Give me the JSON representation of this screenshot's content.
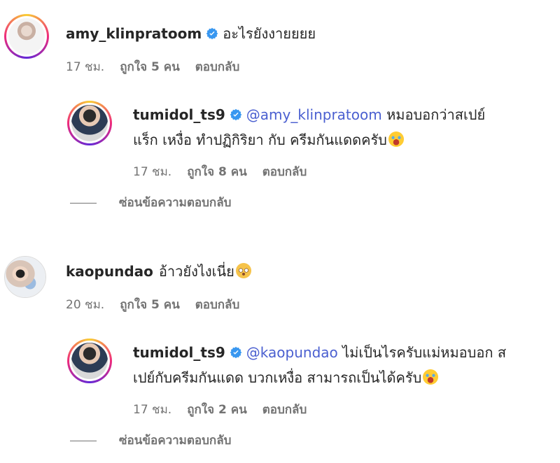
{
  "comments": [
    {
      "username": "amy_klinpratoom",
      "text": "อะไรยังงายยยย",
      "time": "17 ชม.",
      "likes": "ถูกใจ 5 คน",
      "reply": "ตอบกลับ",
      "verified": true,
      "replies": [
        {
          "username": "tumidol_ts9",
          "mention": "@amy_klinpratoom",
          "text_line1": " หมอบอกว่าสเปย์",
          "text_line2": "แร็ก เหงื่อ ทำปฏิกิริยา กับ ครีมกันแดดครับ",
          "time": "17 ชม.",
          "likes": "ถูกใจ 8 คน",
          "reply": "ตอบกลับ",
          "verified": true,
          "emoji": "face-with-tears-of-joy"
        }
      ],
      "hide_replies": "ซ่อนข้อความตอบกลับ"
    },
    {
      "username": "kaopundao",
      "text": "อ้าวยังไงเนี่ย",
      "time": "20 ชม.",
      "likes": "ถูกใจ 5 คน",
      "reply": "ตอบกลับ",
      "verified": false,
      "emoji": "pleading-face",
      "replies": [
        {
          "username": "tumidol_ts9",
          "mention": "@kaopundao",
          "text_line1": " ไม่เป็นไรครับแม่หมอบอก ส",
          "text_line2": "เปย์กับครีมกันแดด บวกเหงื่อ สามารถเป็นได้ครับ",
          "time": "17 ชม.",
          "likes": "ถูกใจ 2 คน",
          "reply": "ตอบกลับ",
          "verified": true,
          "emoji": "face-with-tears-of-joy"
        }
      ],
      "hide_replies": "ซ่อนข้อความตอบกลับ"
    }
  ],
  "colors": {
    "verified": "#3897f0",
    "mention": "#4a5fd0",
    "meta": "#737373"
  }
}
